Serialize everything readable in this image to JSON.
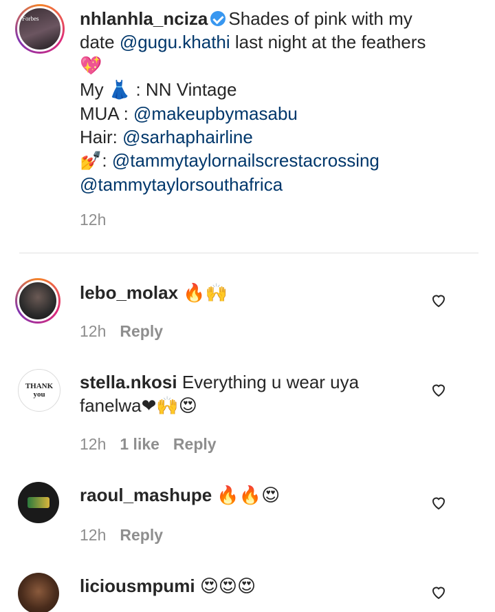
{
  "post": {
    "username": "nhlanhla_nciza",
    "lines": [
      {
        "text": "Shades of pink with my"
      },
      {
        "prefix": "date ",
        "mention": "@gugu.khathi",
        "suffix": " last night at the feathers"
      },
      {
        "emoji": "💖"
      },
      {
        "prefix": "My ",
        "emoji": "👗",
        "suffix": " : NN Vintage"
      },
      {
        "prefix": "MUA : ",
        "mention": "@makeupbymasabu"
      },
      {
        "prefix": "Hair: ",
        "mention": "@sarhaphairline"
      },
      {
        "emoji": "💅",
        "prefix": ": ",
        "mention": "@tammytaylornailscrestacrossing"
      },
      {
        "mention": "@tammytaylorsouthafrica"
      }
    ],
    "time": "12h",
    "avatar_text": "Forbes"
  },
  "comments": [
    {
      "username": "lebo_molax",
      "text": "🔥🙌",
      "time": "12h",
      "likes": "",
      "reply": "Reply"
    },
    {
      "username": "stella.nkosi",
      "text1": "Everything u wear uya",
      "text2": "fanelwa",
      "emoji_tail": "❤🙌😍",
      "time": "12h",
      "likes": "1 like",
      "reply": "Reply",
      "avatar_text": "THANK you"
    },
    {
      "username": "raoul_mashupe",
      "text": "🔥🔥😍",
      "time": "12h",
      "likes": "",
      "reply": "Reply"
    },
    {
      "username": "liciousmpumi",
      "text": "😍😍😍",
      "time": "",
      "likes": "",
      "reply": ""
    }
  ],
  "colors": {
    "mention": "#00376b",
    "meta": "#8e8e8e",
    "text": "#262626",
    "verified": "#3897f0"
  }
}
